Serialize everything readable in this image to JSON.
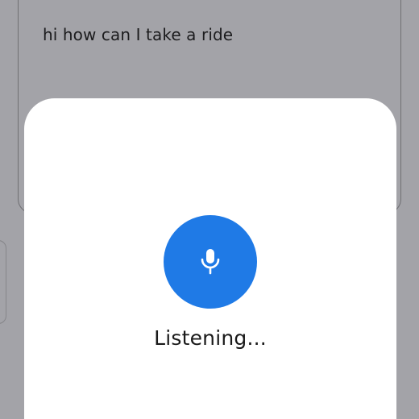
{
  "query": {
    "text": "hi how can I take a ride"
  },
  "voice_sheet": {
    "status": "Listening...",
    "mic_icon": "microphone-icon",
    "accent_color": "#1f7ae6"
  }
}
